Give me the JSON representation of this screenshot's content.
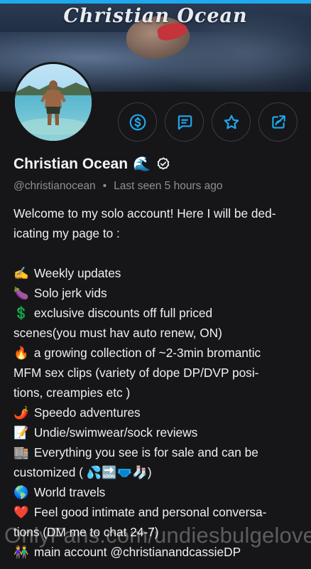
{
  "cover": {
    "title": "Christian Ocean"
  },
  "profile": {
    "name": "Christian Ocean",
    "name_emoji": "🌊",
    "handle": "@christianocean",
    "separator": "•",
    "last_seen": "Last seen 5 hours ago"
  },
  "actions": [
    {
      "name": "tip-button",
      "icon": "dollar-circle-icon"
    },
    {
      "name": "message-button",
      "icon": "message-square-icon"
    },
    {
      "name": "favorite-button",
      "icon": "star-icon"
    },
    {
      "name": "share-button",
      "icon": "share-icon"
    }
  ],
  "colors": {
    "accent": "#1fa8ee",
    "background": "#161618",
    "muted": "#8e8f96"
  },
  "bio": {
    "lines": [
      {
        "emoji": "",
        "text": "Welcome to my solo account! Here I will be ded-"
      },
      {
        "emoji": "",
        "text": "icating my page to :"
      },
      {
        "emoji": "",
        "text": ""
      },
      {
        "emoji": "✍️",
        "text": "Weekly updates"
      },
      {
        "emoji": "🍆",
        "text": "Solo jerk vids"
      },
      {
        "emoji": "💲",
        "text": "exclusive discounts off full priced"
      },
      {
        "emoji": "",
        "text": "scenes(you must hav auto renew, ON)"
      },
      {
        "emoji": "🔥",
        "text": "a growing collection of ~2-3min bromantic"
      },
      {
        "emoji": "",
        "text": "MFM sex clips (variety of dope DP/DVP posi-"
      },
      {
        "emoji": "",
        "text": "tions, creampies etc )"
      },
      {
        "emoji": "🌶️",
        "text": "Speedo adventures"
      },
      {
        "emoji": "📝",
        "text": "Undie/swimwear/sock reviews"
      },
      {
        "emoji": "🏬",
        "text": "Everything you see is for sale and can be"
      },
      {
        "emoji": "",
        "text": "customized ( 💦🔜🩲🧦)"
      },
      {
        "emoji": "🌎",
        "text": "World travels"
      },
      {
        "emoji": "❤️",
        "text": "Feel good intimate and personal conversa-"
      },
      {
        "emoji": "",
        "text": "tions (DM me to chat 24-7)"
      },
      {
        "emoji": "👫",
        "text": "main account @christianandcassieDP"
      }
    ]
  },
  "watermark": "OnlyFans.com/undiesbulgelover"
}
